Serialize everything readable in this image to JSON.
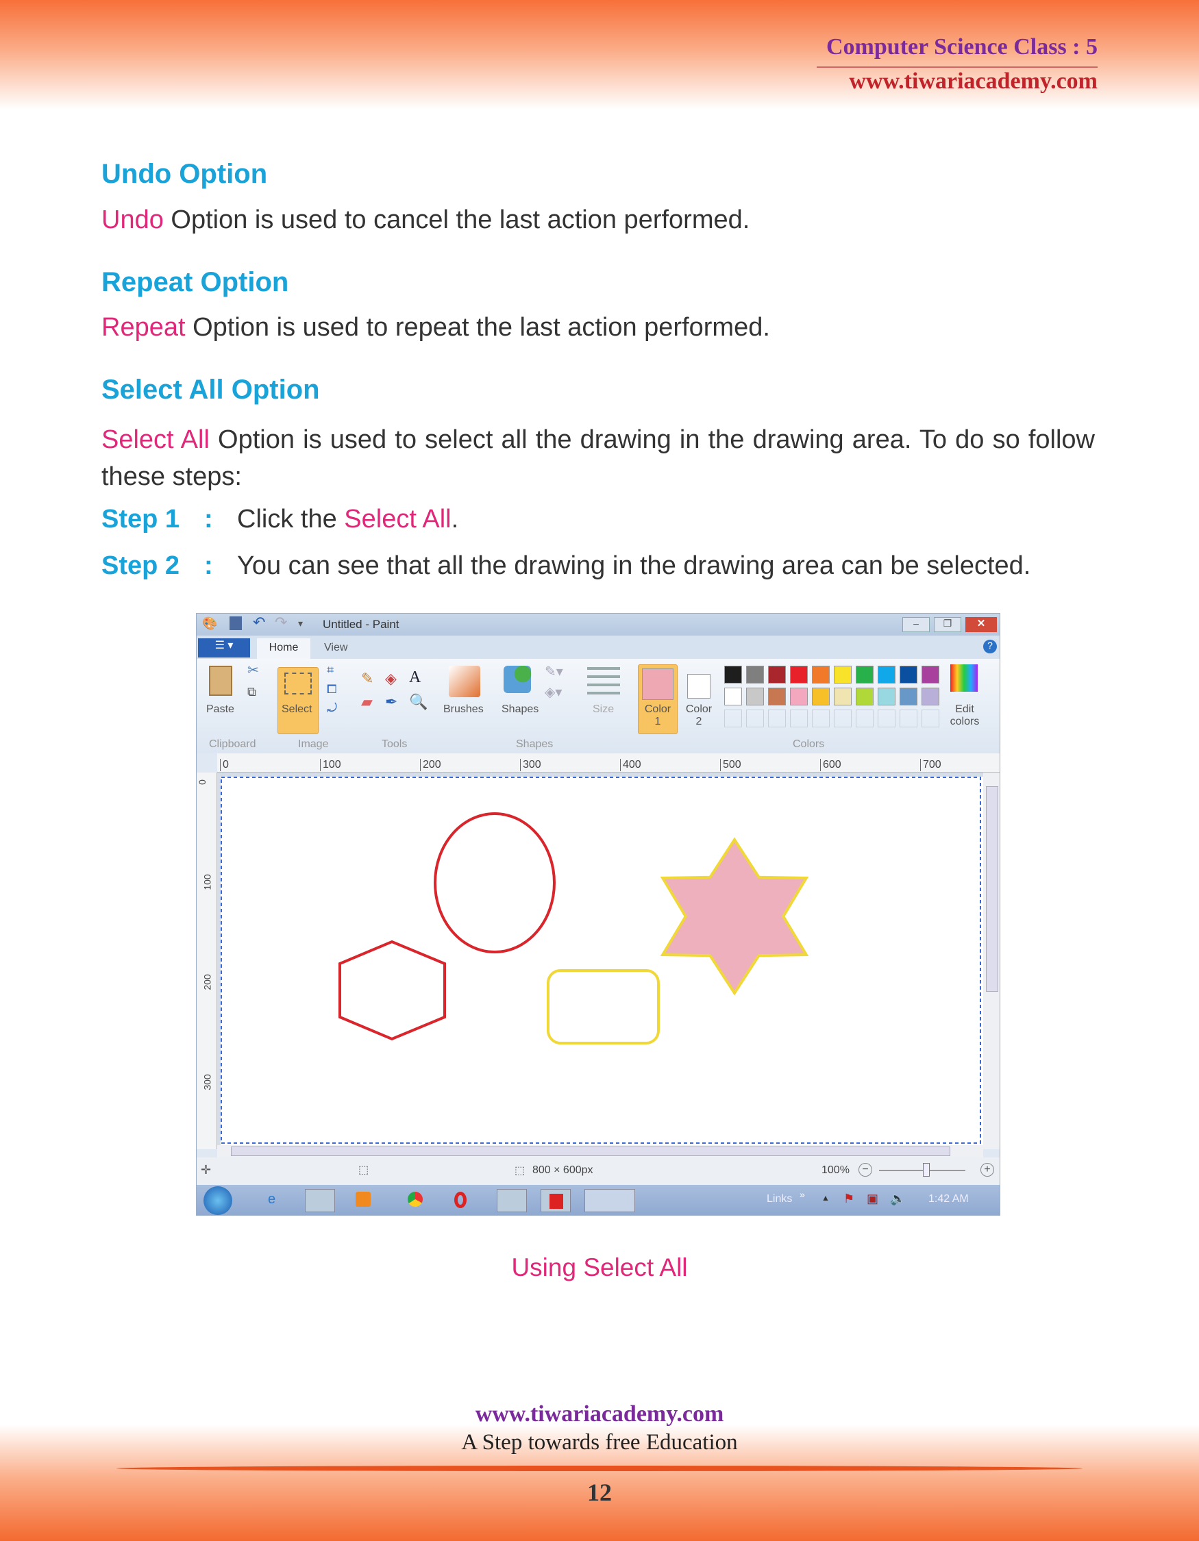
{
  "header": {
    "class": "Computer Science Class : 5",
    "website": "www.tiwariacademy.com"
  },
  "sections": [
    {
      "heading": "Undo Option",
      "term": "Undo",
      "text": " Option is used to cancel the last action performed."
    },
    {
      "heading": "Repeat Option",
      "term": "Repeat",
      "text": " Option is used to repeat the last action performed."
    },
    {
      "heading": "Select All Option",
      "term": "Select All",
      "text": " Option is used to select all the drawing in the drawing area. To do so follow these steps:"
    }
  ],
  "steps": [
    {
      "label": "Step 1",
      "colon": ":",
      "pre": "Click the ",
      "term": "Select All",
      "post": "."
    },
    {
      "label": "Step 2",
      "colon": ":",
      "pre": "You can see that all the drawing in the drawing area can be selected.",
      "term": "",
      "post": ""
    }
  ],
  "paint": {
    "title": "Untitled - Paint",
    "tabs": [
      "Home",
      "View"
    ],
    "buttons": {
      "paste": "Paste",
      "select": "Select",
      "brushes": "Brushes",
      "shapes": "Shapes",
      "size": "Size",
      "color1": "Color\n1",
      "color2": "Color\n2",
      "edit_colors": "Edit colors"
    },
    "groups": [
      "Clipboard",
      "Image",
      "Tools",
      "Shapes",
      "Colors"
    ],
    "ruler": [
      "0",
      "100",
      "200",
      "300",
      "400",
      "500",
      "600",
      "700"
    ],
    "vruler": [
      "0",
      "100",
      "200",
      "300"
    ],
    "palette_row1": [
      "#1e1e1e",
      "#7f7f7f",
      "#a8262c",
      "#e8202a",
      "#f07a2a",
      "#f8e22a",
      "#28b04a",
      "#10a8e8",
      "#0a4fa0",
      "#a8409e"
    ],
    "palette_row2": [
      "#ffffff",
      "#c8c8c8",
      "#c87850",
      "#f4a8c0",
      "#f8c028",
      "#f0e4b0",
      "#b0d838",
      "#98d8e0",
      "#6898c8",
      "#b8b0d8"
    ],
    "color1": "#eea8b4",
    "shape_colors": {
      "ellipse": "#d8262c",
      "hexagon": "#d8262c",
      "rect": "#f0d838",
      "star_fill": "#eeb0bc",
      "star_stroke": "#f0d838"
    },
    "status": {
      "size": "800 × 600px",
      "zoom": "100%"
    },
    "taskbar": {
      "links": "Links",
      "time": "1:42 AM"
    }
  },
  "caption": "Using Select All",
  "footer": {
    "website": "www.tiwariacademy.com",
    "tagline": "A Step towards free Education",
    "page": "12"
  }
}
